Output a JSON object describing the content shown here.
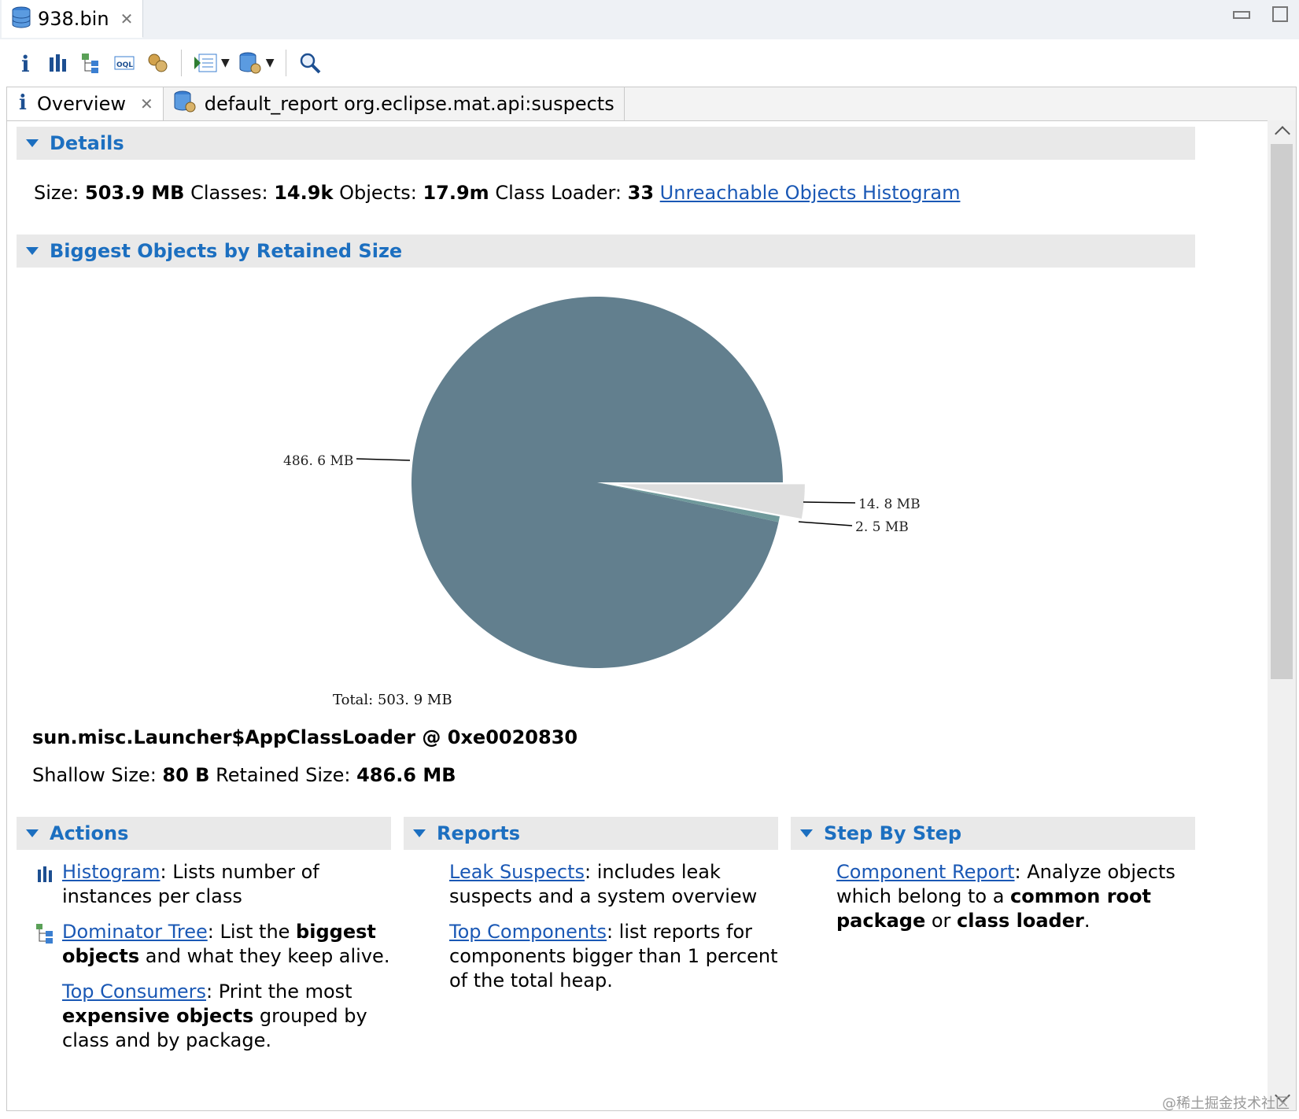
{
  "file_tab": {
    "label": "938.bin"
  },
  "subtabs": [
    {
      "label": "Overview"
    },
    {
      "label": "default_report  org.eclipse.mat.api:suspects"
    }
  ],
  "toolbar_icons": [
    "info-icon",
    "histogram-icon",
    "dominator-tree-icon",
    "oql-icon",
    "heap-dump-overview-icon",
    "run-report-icon",
    "leak-suspects-icon",
    "search-icon"
  ],
  "details": {
    "header": "Details",
    "size_label": "Size:",
    "size": "503.9 MB",
    "classes_label": "Classes:",
    "classes": "14.9k",
    "objects_label": "Objects:",
    "objects": "17.9m",
    "loader_label": "Class Loader:",
    "loader": "33",
    "link": "Unreachable Objects Histogram"
  },
  "biggest": {
    "header": "Biggest Objects by Retained Size",
    "object_name": "sun.misc.Launcher$AppClassLoader @ 0xe0020830",
    "shallow_label": "Shallow Size:",
    "shallow": "80 B",
    "retained_label": "Retained Size:",
    "retained": "486.6 MB"
  },
  "chart_data": {
    "type": "pie",
    "values": [
      486.6,
      14.8,
      2.5
    ],
    "labels": [
      "486. 6  MB",
      "14. 8  MB",
      "2. 5  MB"
    ],
    "colors": [
      "#627f8e",
      "#dedede",
      "#6f999b"
    ],
    "total_label": "Total:  503. 9  MB"
  },
  "actions": {
    "header": "Actions",
    "histogram_link": "Histogram",
    "histogram_text": ": Lists number of",
    "histogram_text2": "instances per class",
    "dominator_link": "Dominator Tree",
    "dominator_text": ": List the ",
    "dominator_bold1": "biggest",
    "dominator_bold2": "objects",
    "dominator_text2": " and what they keep alive.",
    "top_consumers_link": "Top Consumers",
    "top_consumers_text": ": Print the most",
    "top_consumers_bold": "expensive objects",
    "top_consumers_text2": " grouped by",
    "top_consumers_text3": "class and by package."
  },
  "reports": {
    "header": "Reports",
    "leak_link": "Leak Suspects",
    "leak_text": ": includes leak",
    "leak_text2": "suspects and a system overview",
    "top_components_link": "Top Components",
    "top_components_text": ": list reports for",
    "top_components_text2": "components bigger than 1 percent",
    "top_components_text3": "of the total heap."
  },
  "step_by_step": {
    "header": "Step By Step",
    "component_link": "Component Report",
    "component_text": ": Analyze objects",
    "component_text2": "which belong to a ",
    "component_bold1": "common root",
    "component_bold2": "package",
    "component_text3": " or ",
    "component_bold3": "class loader",
    "component_text4": "."
  },
  "watermark": "@稀土掘金技术社区"
}
